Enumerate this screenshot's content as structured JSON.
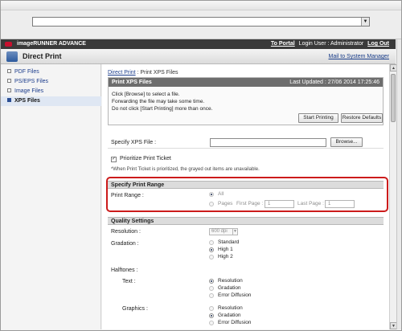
{
  "browser": {
    "url_dropdown_glyph": "▼"
  },
  "header": {
    "brand": "imageRUNNER ADVANCE",
    "to_portal": "To Portal",
    "login_user": "Login User : Administrator",
    "logout": "Log Out",
    "app_title": "Direct Print",
    "mail_link": "Mail to System Manager"
  },
  "sidebar": {
    "items": [
      {
        "label": "PDF Files"
      },
      {
        "label": "PS/EPS Files"
      },
      {
        "label": "Image Files"
      },
      {
        "label": "XPS Files"
      }
    ]
  },
  "breadcrumb": {
    "root": "Direct Print",
    "sep": ":",
    "current": "Print XPS Files"
  },
  "panel": {
    "title": "Print XPS Files",
    "last_updated": "Last Updated : 27/06 2014 17:25:46",
    "line1": "Click [Browse] to select a file.",
    "line2": "Forwarding the file may take some time.",
    "line3": "Do not click [Start Printing] more than once.",
    "start_btn": "Start Printing",
    "restore_btn": "Restore Defaults"
  },
  "specify_file": {
    "label": "Specify XPS File :",
    "browse": "Browse..."
  },
  "ticket": {
    "label": "Prioritize Print Ticket",
    "check_glyph": "✓",
    "note": "*When Print Ticket is prioritized, the grayed out items are unavailable."
  },
  "print_range": {
    "title": "Specify Print Range",
    "label": "Print Range :",
    "all": "All",
    "pages": "Pages",
    "first_page_label": "First Page :",
    "first_page_value": "1",
    "last_page_label": "Last Page :",
    "last_page_value": "1"
  },
  "quality": {
    "title": "Quality Settings",
    "resolution_label": "Resolution :",
    "resolution_value": "600 dpi",
    "gradation_label": "Gradation :",
    "gradation_options": [
      "Standard",
      "High 1",
      "High 2"
    ],
    "halftones_label": "Halftones :",
    "text_label": "Text :",
    "graphics_label": "Graphics :",
    "halftone_options": [
      "Resolution",
      "Gradation",
      "Error Diffusion"
    ]
  },
  "scroll": {
    "up": "▲",
    "down": "▼"
  }
}
